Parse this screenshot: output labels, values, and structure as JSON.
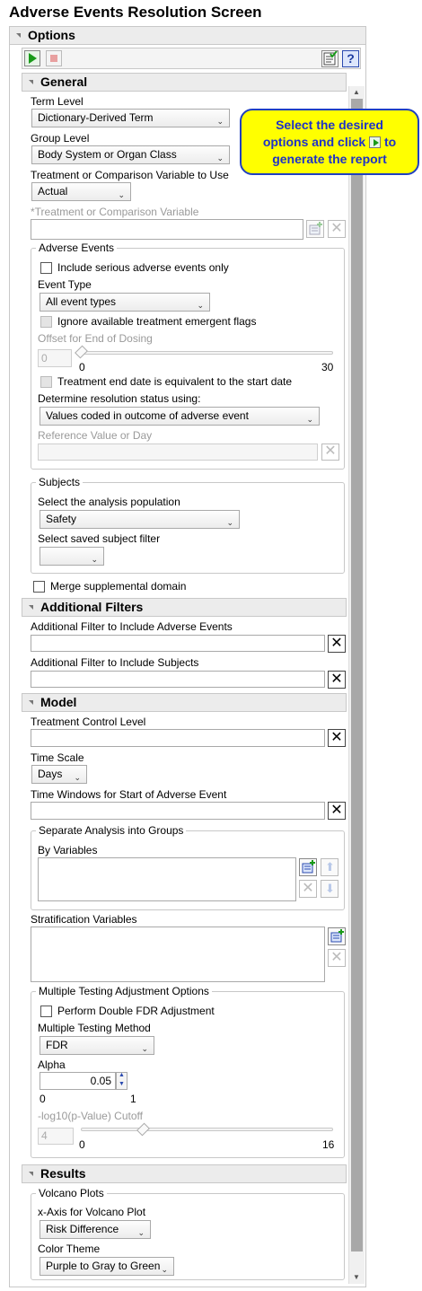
{
  "title": "Adverse Events Resolution Screen",
  "options_header": "Options",
  "callout": {
    "line1": "Select the desired",
    "line2a": "options and click",
    "line2b": "to",
    "line3": "generate the report"
  },
  "general": {
    "header": "General",
    "term_level_label": "Term Level",
    "term_level_value": "Dictionary-Derived Term",
    "group_level_label": "Group Level",
    "group_level_value": "Body System or Organ Class",
    "trt_var_use_label": "Treatment or Comparison Variable to Use",
    "trt_var_use_value": "Actual",
    "trt_var_label": "*Treatment or Comparison Variable",
    "adverse_events": {
      "title": "Adverse Events",
      "serious_only_label": "Include serious adverse events only",
      "event_type_label": "Event Type",
      "event_type_value": "All event types",
      "ignore_te_flags_label": "Ignore available treatment emergent flags",
      "offset_label": "Offset for End of Dosing",
      "offset_value": "0",
      "offset_min": "0",
      "offset_max": "30",
      "trt_end_label": "Treatment end date is equivalent to the start date",
      "resolution_label": "Determine resolution status using:",
      "resolution_value": "Values coded in outcome of adverse event",
      "reference_label": "Reference Value or Day"
    },
    "subjects": {
      "title": "Subjects",
      "population_label": "Select the analysis population",
      "population_value": "Safety",
      "saved_filter_label": "Select saved subject filter",
      "saved_filter_value": ""
    },
    "merge_supp_label": "Merge supplemental domain"
  },
  "additional_filters": {
    "header": "Additional Filters",
    "ae_filter_label": "Additional Filter to Include Adverse Events",
    "subj_filter_label": "Additional Filter to Include Subjects"
  },
  "model": {
    "header": "Model",
    "control_level_label": "Treatment Control Level",
    "time_scale_label": "Time Scale",
    "time_scale_value": "Days",
    "time_windows_label": "Time Windows for Start of Adverse Event",
    "separate": {
      "title": "Separate Analysis into Groups",
      "by_vars_label": "By Variables"
    },
    "stratification_label": "Stratification Variables",
    "mult_testing": {
      "title": "Multiple Testing Adjustment Options",
      "double_fdr_label": "Perform Double FDR Adjustment",
      "method_label": "Multiple Testing Method",
      "method_value": "FDR",
      "alpha_label": "Alpha",
      "alpha_value": "0.05",
      "alpha_min": "0",
      "alpha_max": "1",
      "cutoff_label": "-log10(p-Value) Cutoff",
      "cutoff_value": "4",
      "cutoff_min": "0",
      "cutoff_max": "16"
    }
  },
  "results": {
    "header": "Results",
    "volcano": {
      "title": "Volcano Plots",
      "xaxis_label": "x-Axis for Volcano Plot",
      "xaxis_value": "Risk Difference",
      "color_theme_label": "Color Theme",
      "color_theme_value": "Purple to Gray to Green"
    }
  }
}
